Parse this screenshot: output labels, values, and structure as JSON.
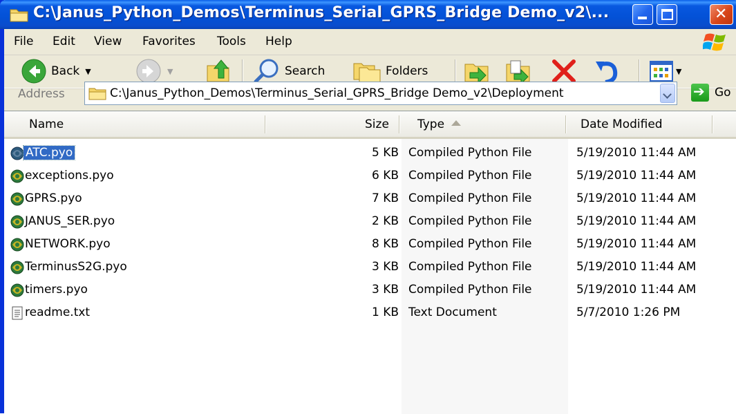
{
  "window": {
    "title": "C:\\Janus_Python_Demos\\Terminus_Serial_GPRS_Bridge Demo_v2\\..."
  },
  "menu": [
    "File",
    "Edit",
    "View",
    "Favorites",
    "Tools",
    "Help"
  ],
  "toolbar": {
    "back_label": "Back",
    "search_label": "Search",
    "folders_label": "Folders"
  },
  "address": {
    "label": "Address",
    "value": "C:\\Janus_Python_Demos\\Terminus_Serial_GPRS_Bridge Demo_v2\\Deployment",
    "go_label": "Go"
  },
  "columns": {
    "name": "Name",
    "size": "Size",
    "type": "Type",
    "date": "Date Modified"
  },
  "files": [
    {
      "name": "ATC.pyo",
      "size": "5 KB",
      "type": "Compiled Python File",
      "date": "5/19/2010 11:44 AM",
      "icon": "python-compiled-icon",
      "selected": true
    },
    {
      "name": "exceptions.pyo",
      "size": "6 KB",
      "type": "Compiled Python File",
      "date": "5/19/2010 11:44 AM",
      "icon": "python-compiled-icon"
    },
    {
      "name": "GPRS.pyo",
      "size": "7 KB",
      "type": "Compiled Python File",
      "date": "5/19/2010 11:44 AM",
      "icon": "python-compiled-icon"
    },
    {
      "name": "JANUS_SER.pyo",
      "size": "2 KB",
      "type": "Compiled Python File",
      "date": "5/19/2010 11:44 AM",
      "icon": "python-compiled-icon"
    },
    {
      "name": "NETWORK.pyo",
      "size": "8 KB",
      "type": "Compiled Python File",
      "date": "5/19/2010 11:44 AM",
      "icon": "python-compiled-icon"
    },
    {
      "name": "TerminusS2G.pyo",
      "size": "3 KB",
      "type": "Compiled Python File",
      "date": "5/19/2010 11:44 AM",
      "icon": "python-compiled-icon"
    },
    {
      "name": "timers.pyo",
      "size": "3 KB",
      "type": "Compiled Python File",
      "date": "5/19/2010 11:44 AM",
      "icon": "python-compiled-icon"
    },
    {
      "name": "readme.txt",
      "size": "1 KB",
      "type": "Text Document",
      "date": "5/7/2010 1:26 PM",
      "icon": "text-document-icon"
    }
  ],
  "colors": {
    "titlebar": "#0351d6",
    "selection": "#316ac5",
    "toolbar_bg": "#ece9d8"
  }
}
